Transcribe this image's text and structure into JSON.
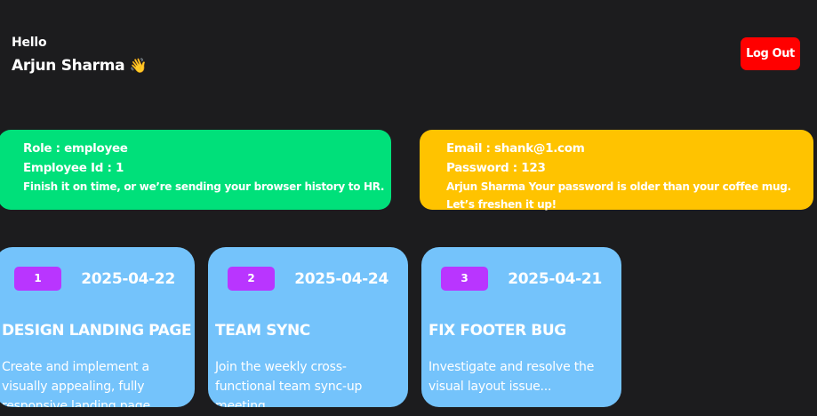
{
  "header": {
    "greeting": "Hello",
    "user_name": "Arjun Sharma",
    "wave_emoji": "👋",
    "logout_label": "Log Out"
  },
  "info_cards": {
    "employee": {
      "role_line": "Role : employee",
      "id_line": "Employee Id : 1",
      "note": "Finish it on time, or we’re sending your browser history to HR."
    },
    "account": {
      "email_line": "Email : shank@1.com",
      "password_line": "Password : 123",
      "note": "Arjun Sharma Your password is older than your coffee mug. Let’s freshen it up!"
    }
  },
  "tasks": [
    {
      "number": "1",
      "date": "2025-04-22",
      "title": "DESIGN LANDING PAGE",
      "description": "Create and implement a visually appealing, fully responsive landing page"
    },
    {
      "number": "2",
      "date": "2025-04-24",
      "title": "TEAM SYNC",
      "description": "Join the weekly cross-functional team sync-up meeting"
    },
    {
      "number": "3",
      "date": "2025-04-21",
      "title": "FIX FOOTER BUG",
      "description": "Investigate and resolve the visual layout issue..."
    }
  ],
  "colors": {
    "background": "#1c1c1e",
    "logout": "#ff0000",
    "employee_card": "#00e07a",
    "account_card": "#ffc300",
    "task_card": "#74c3fb",
    "task_badge": "#b935ff"
  }
}
